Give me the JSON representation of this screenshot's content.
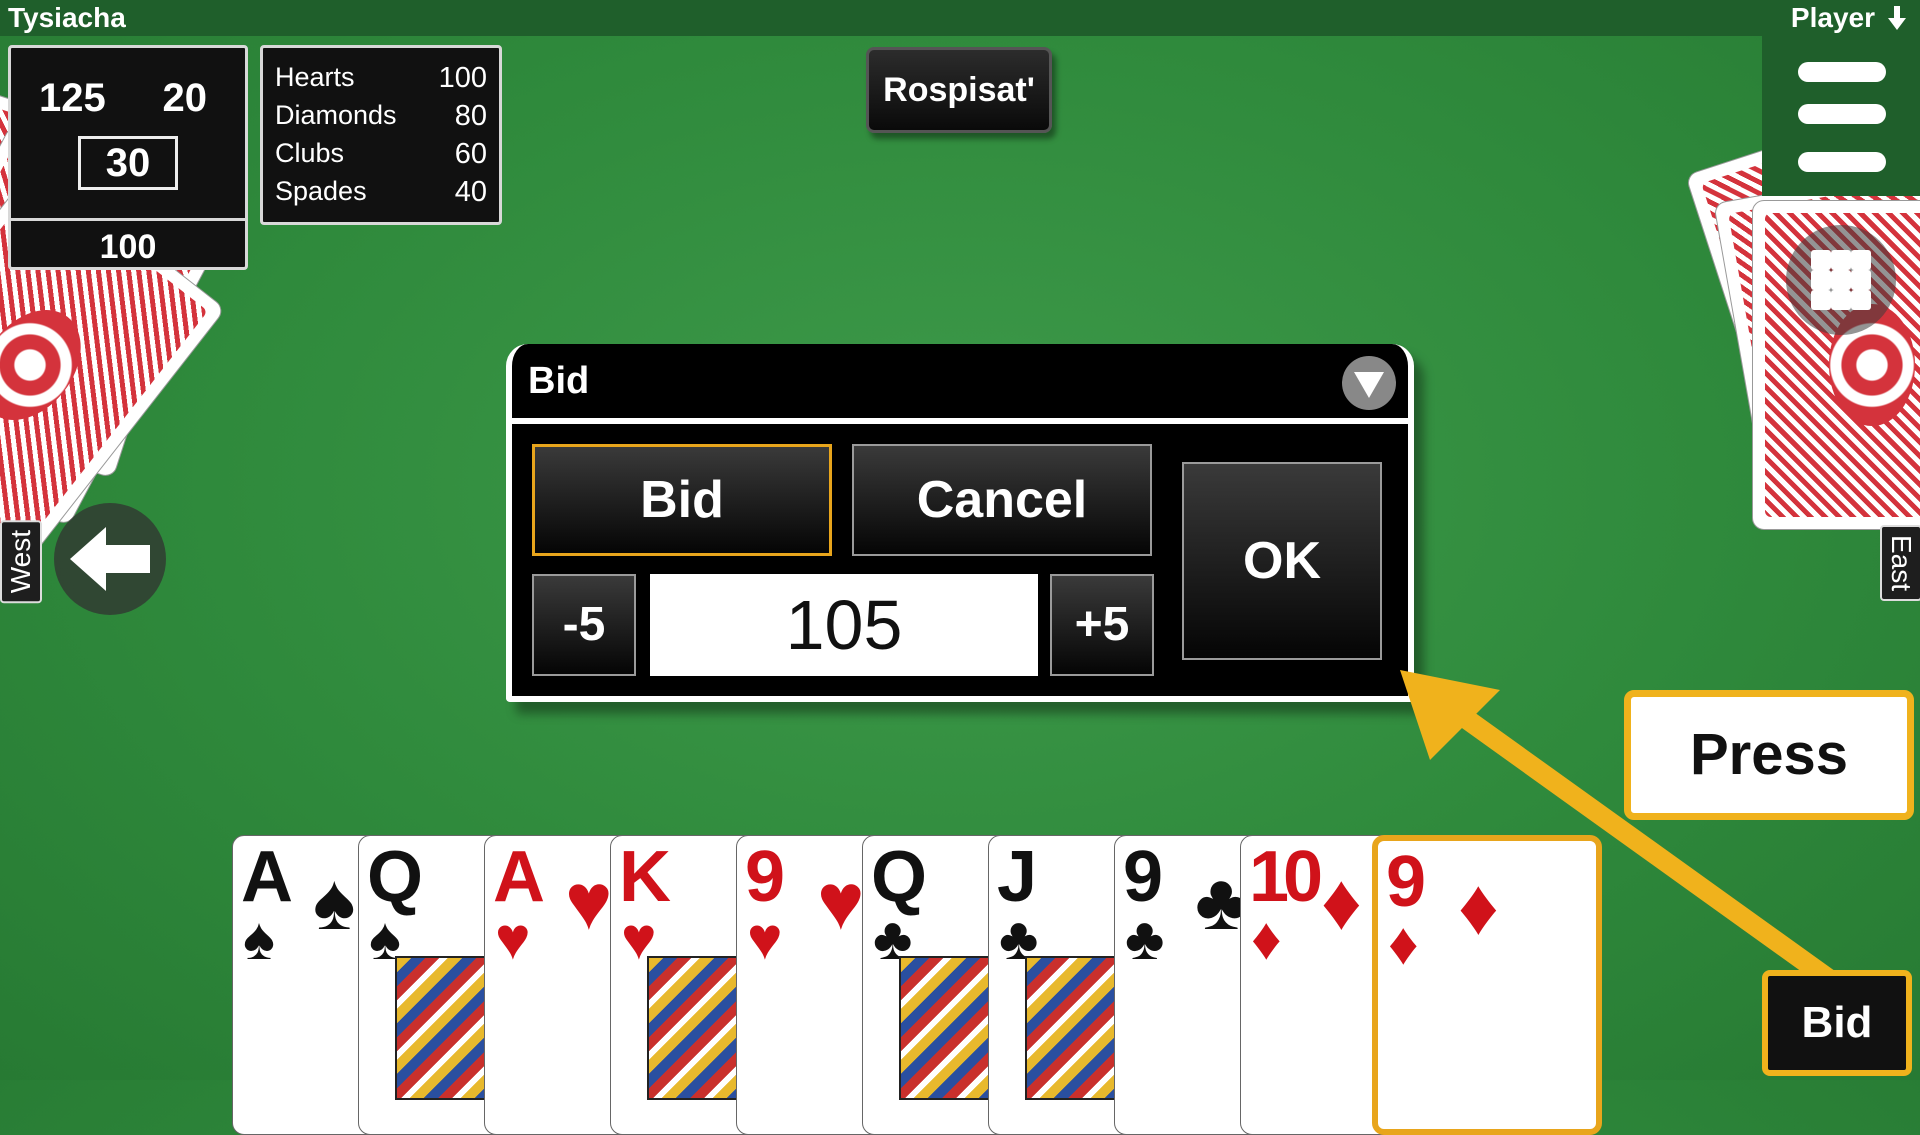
{
  "app": {
    "title": "Tysiacha",
    "player_label": "Player"
  },
  "score": {
    "left": "125",
    "right": "20",
    "boxed": "30",
    "bottom": "100"
  },
  "suits": [
    {
      "name": "Hearts",
      "value": "100"
    },
    {
      "name": "Diamonds",
      "value": "80"
    },
    {
      "name": "Clubs",
      "value": "60"
    },
    {
      "name": "Spades",
      "value": "40"
    }
  ],
  "buttons": {
    "rospisat": "Rospisat'"
  },
  "seats": {
    "west": "West",
    "east": "East"
  },
  "dialog": {
    "title": "Bid",
    "bid_label": "Bid",
    "cancel_label": "Cancel",
    "ok_label": "OK",
    "minus_label": "-5",
    "plus_label": "+5",
    "bid_value": "105"
  },
  "hint": {
    "press_label": "Press",
    "corner_button": "Bid"
  },
  "hand": [
    {
      "rank": "A",
      "suit": "♠",
      "color": "black"
    },
    {
      "rank": "Q",
      "suit": "♠",
      "color": "black"
    },
    {
      "rank": "A",
      "suit": "♥",
      "color": "red"
    },
    {
      "rank": "K",
      "suit": "♥",
      "color": "red"
    },
    {
      "rank": "9",
      "suit": "♥",
      "color": "red"
    },
    {
      "rank": "Q",
      "suit": "♣",
      "color": "black"
    },
    {
      "rank": "J",
      "suit": "♣",
      "color": "black"
    },
    {
      "rank": "9",
      "suit": "♣",
      "color": "black"
    },
    {
      "rank": "10",
      "suit": "♦",
      "color": "red"
    },
    {
      "rank": "9",
      "suit": "♦",
      "color": "red"
    }
  ],
  "colors": {
    "felt": "#2f8a3c",
    "highlight": "#f0b21c",
    "card_red": "#d0121a"
  }
}
